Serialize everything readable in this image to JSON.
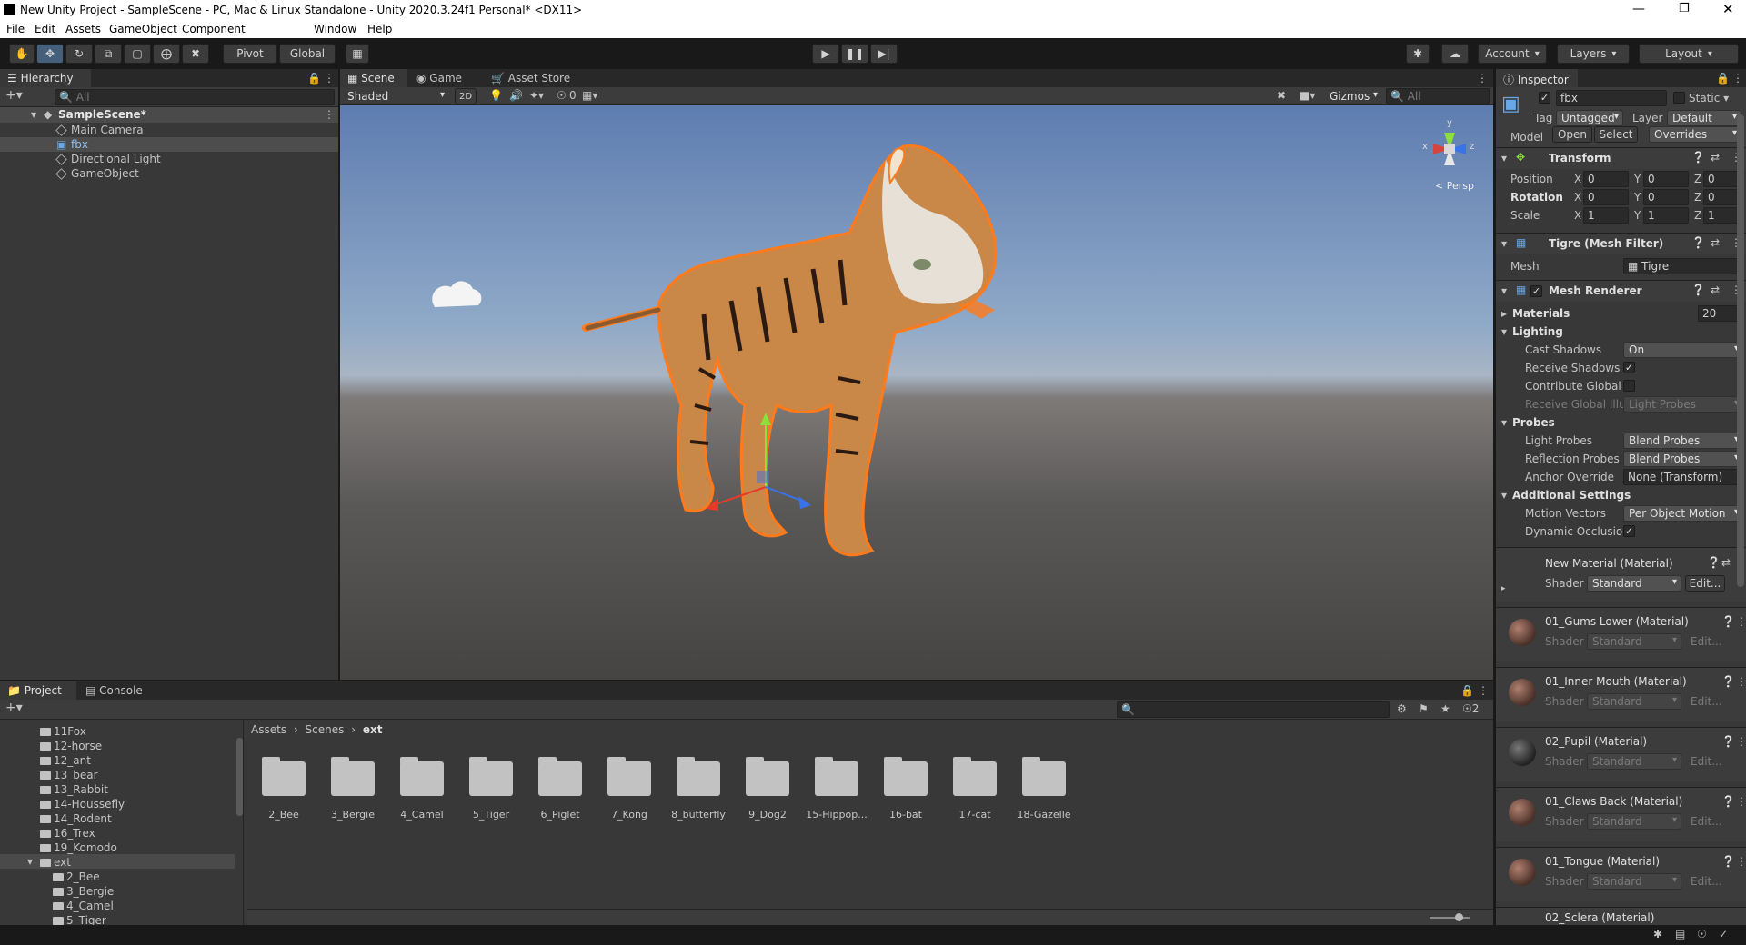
{
  "window": {
    "title": "New Unity Project - SampleScene - PC, Mac & Linux Standalone - Unity 2020.3.24f1 Personal* <DX11>"
  },
  "menu": [
    "File",
    "Edit",
    "Assets",
    "GameObject",
    "Component",
    "Window",
    "Help"
  ],
  "toolbar": {
    "pivot": "Pivot",
    "global": "Global",
    "account": "Account",
    "layers": "Layers",
    "layout": "Layout"
  },
  "hierarchy": {
    "tab": "Hierarchy",
    "search_placeholder": "All",
    "scene": "SampleScene*",
    "items": [
      "Main Camera",
      "fbx",
      "Directional Light",
      "GameObject"
    ]
  },
  "scene_view": {
    "tabs": [
      "Scene",
      "Game",
      "Asset Store"
    ],
    "shading": "Shaded",
    "mode_2d": "2D",
    "hidden_count": "0",
    "gizmos": "Gizmos",
    "search_placeholder": "All",
    "persp": "Persp",
    "gizmo_axes": {
      "x": "x",
      "y": "y",
      "z": "z"
    }
  },
  "inspector": {
    "tab": "Inspector",
    "object_name": "fbx",
    "static_label": "Static",
    "tag_label": "Tag",
    "tag": "Untagged",
    "layer_label": "Layer",
    "layer": "Default",
    "model_label": "Model",
    "open": "Open",
    "select": "Select",
    "overrides": "Overrides",
    "transform": {
      "title": "Transform",
      "rows": [
        {
          "label": "Position",
          "x": "0",
          "y": "0",
          "z": "0"
        },
        {
          "label": "Rotation",
          "x": "0",
          "y": "0",
          "z": "0"
        },
        {
          "label": "Scale",
          "x": "1",
          "y": "1",
          "z": "1"
        }
      ]
    },
    "mesh_filter": {
      "title": "Tigre (Mesh Filter)",
      "mesh_label": "Mesh",
      "mesh": "Tigre"
    },
    "mesh_renderer": {
      "title": "Mesh Renderer",
      "materials_label": "Materials",
      "materials_count": "20",
      "lighting": "Lighting",
      "cast_shadows_label": "Cast Shadows",
      "cast_shadows": "On",
      "receive_shadows_label": "Receive Shadows",
      "contribute_gi_label": "Contribute Global I",
      "receive_gi_label": "Receive Global Illu",
      "receive_gi": "Light Probes",
      "probes": "Probes",
      "light_probes_label": "Light Probes",
      "light_probes": "Blend Probes",
      "reflection_probes_label": "Reflection Probes",
      "reflection_probes": "Blend Probes",
      "anchor_override_label": "Anchor Override",
      "anchor_override": "None (Transform)",
      "additional": "Additional Settings",
      "motion_vectors_label": "Motion Vectors",
      "motion_vectors": "Per Object Motion",
      "dynamic_occlusion_label": "Dynamic Occlusio"
    },
    "shader_label": "Shader",
    "shader_value": "Standard",
    "edit_label": "Edit...",
    "materials": [
      "New Material (Material)",
      "01_Gums Lower (Material)",
      "01_Inner Mouth (Material)",
      "02_Pupil (Material)",
      "01_Claws Back (Material)",
      "01_Tongue (Material)",
      "02_Sclera (Material)"
    ]
  },
  "project": {
    "tabs": [
      "Project",
      "Console"
    ],
    "hidden_count": "2",
    "tree": [
      "11Fox",
      "12-horse",
      "12_ant",
      "13_bear",
      "13_Rabbit",
      "14-Houssefly",
      "14_Rodent",
      "16_Trex",
      "19_Komodo",
      "ext",
      "2_Bee",
      "3_Bergie",
      "4_Camel",
      "5_Tiger"
    ],
    "breadcrumb": [
      "Assets",
      "Scenes",
      "ext"
    ],
    "folders": [
      "2_Bee",
      "3_Bergie",
      "4_Camel",
      "5_Tiger",
      "6_Piglet",
      "7_Kong",
      "8_butterfly",
      "9_Dog2",
      "15-Hippop...",
      "16-bat",
      "17-cat",
      "18-Gazelle"
    ]
  },
  "colors": {
    "accent": "#46607c",
    "selection": "#2c5d87",
    "panel": "#383838",
    "sky_top": "#5f7fb0",
    "ground": "#4c4c4c",
    "outline": "#ff7a1a"
  }
}
